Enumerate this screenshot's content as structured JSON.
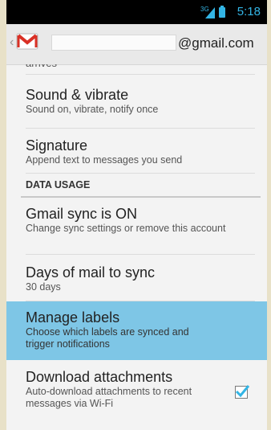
{
  "status_bar": {
    "time": "5:18",
    "network": "3G",
    "icons": [
      "signal-icon",
      "battery-icon"
    ],
    "accent": "#33b5e5"
  },
  "action_bar": {
    "account_domain": "@gmail.com",
    "icons": [
      "back-chevron-icon",
      "gmail-logo-icon"
    ]
  },
  "settings": {
    "partial_item": "arrives",
    "items": [
      {
        "title": "Sound & vibrate",
        "summary": "Sound on, vibrate, notify once"
      },
      {
        "title": "Signature",
        "summary": "Append text to messages you send"
      }
    ],
    "section_header": "DATA USAGE",
    "data_items": [
      {
        "title": "Gmail sync is ON",
        "summary": "Change sync settings or remove this account"
      },
      {
        "title": "Days of mail to sync",
        "summary": "30 days"
      },
      {
        "title": "Manage labels",
        "summary": "Choose which labels are synced and trigger notifications",
        "highlighted": true
      },
      {
        "title": "Download attachments",
        "summary": "Auto-download attachments to recent messages via Wi-Fi",
        "checked": true
      }
    ]
  },
  "colors": {
    "highlight": "#7ec6e6",
    "check": "#33b5e5"
  }
}
